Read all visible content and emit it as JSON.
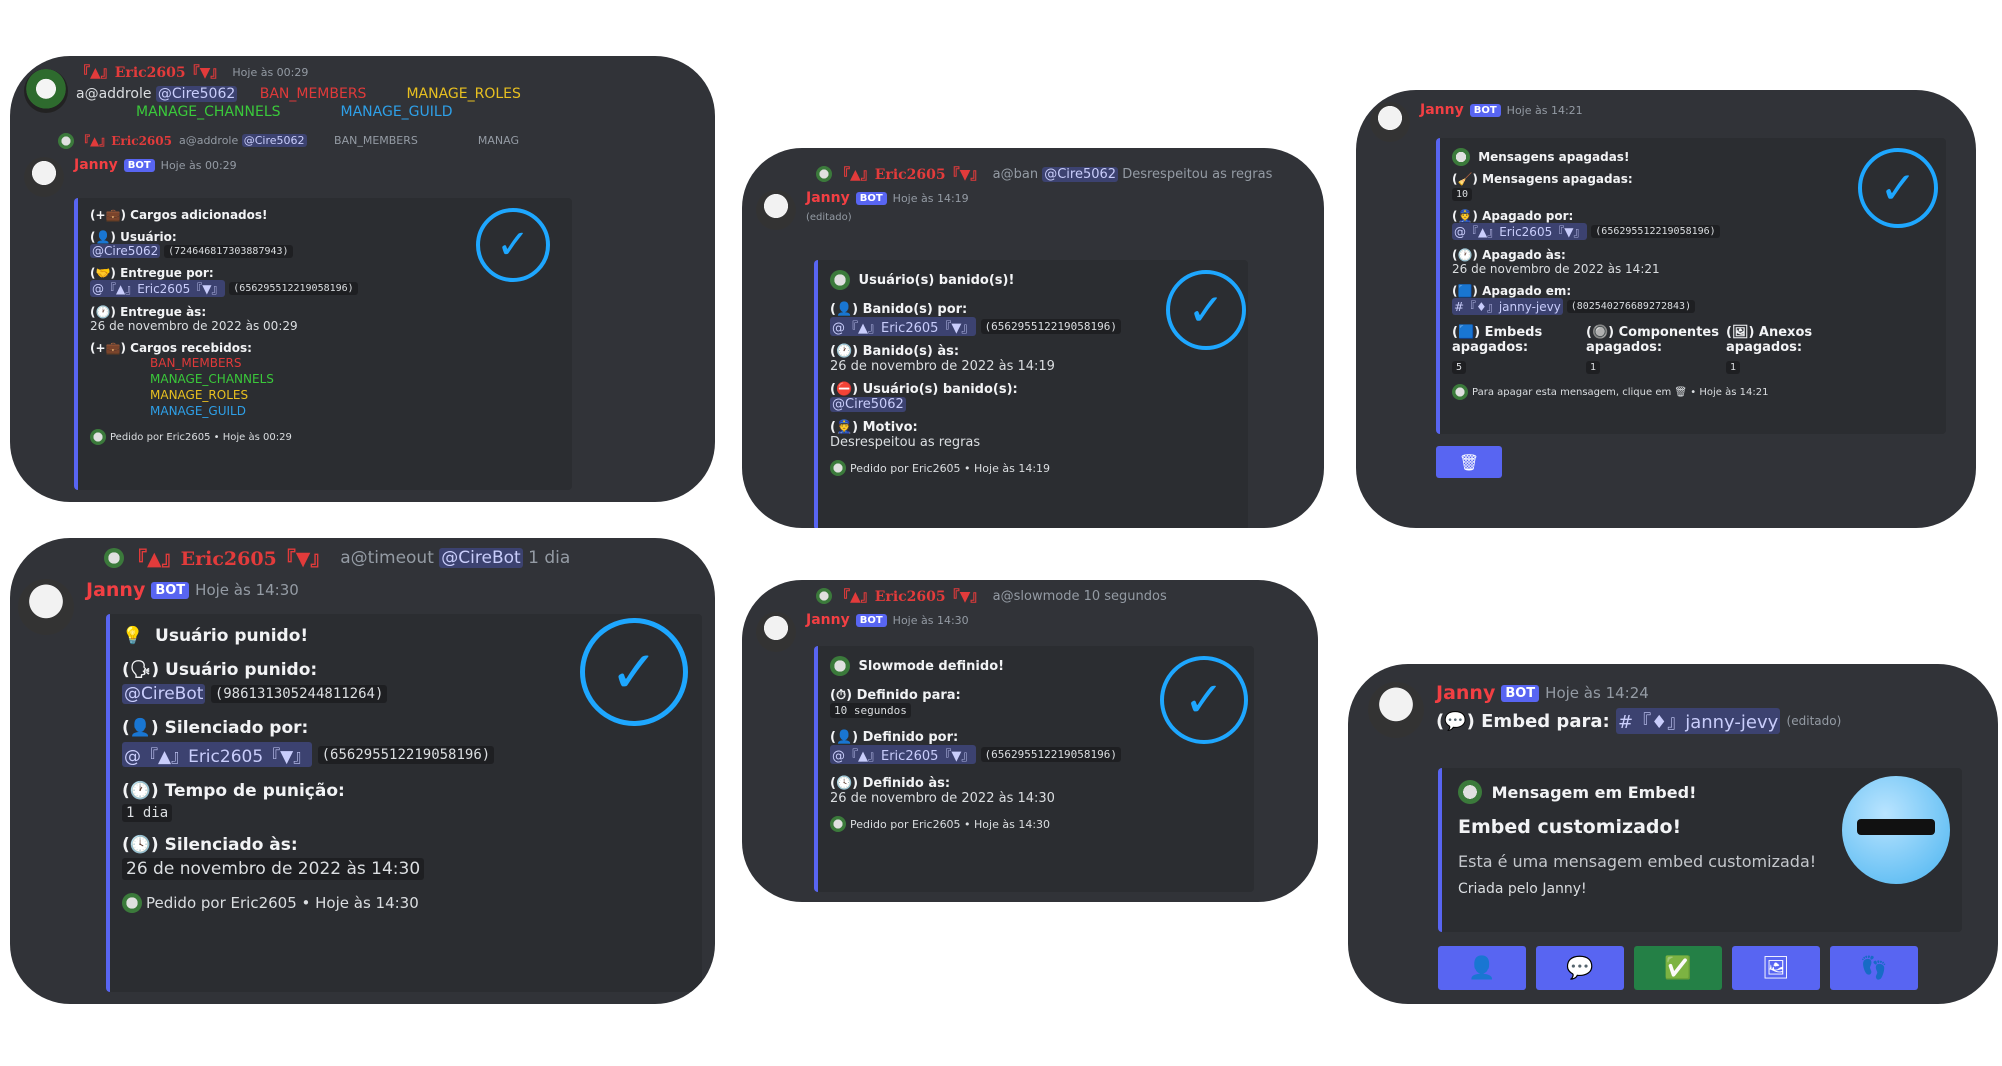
{
  "p1": {
    "user": "『▲』Eric2605『▼』",
    "time": "Hoje às 00:29",
    "cmd_prefix": "a@addrole",
    "mention": "@Cire5062",
    "roles_inline": [
      "BAN_MEMBERS",
      "MANAGE_ROLES",
      "MANAGE_CHANNELS",
      "MANAGE_GUILD"
    ],
    "reply_user": "『▲』Eric2605",
    "reply_text": "a@addrole",
    "reply_mention": "@Cire5062",
    "reply_roles": "BAN_MEMBERS",
    "reply_roles2": "MANAG",
    "bot_name": "Janny",
    "bot_badge": "BOT",
    "bot_time": "Hoje às 00:29",
    "title": "Cargos adicionados!",
    "f1_label": "Usuário:",
    "f1_mention": "@Cire5062",
    "f1_id": "(724646817303887943)",
    "f2_label": "Entregue por:",
    "f2_mention": "@『▲』Eric2605『▼』",
    "f2_id": "(656295512219058196)",
    "f3_label": "Entregue às:",
    "f3_value": "26 de novembro de 2022 às 00:29",
    "f4_label": "Cargos recebidos:",
    "f4_roles": [
      "BAN_MEMBERS",
      "MANAGE_CHANNELS",
      "MANAGE_ROLES",
      "MANAGE_GUILD"
    ],
    "footer": "Pedido por Eric2605 • Hoje às 00:29"
  },
  "p2": {
    "reply_user": "『▲』Eric2605『▼』",
    "reply_text": "a@ban",
    "reply_mention": "@Cire5062",
    "reply_rest": "Desrespeitou as regras",
    "bot_name": "Janny",
    "bot_badge": "BOT",
    "bot_time": "Hoje às 14:19",
    "edited": "(editado)",
    "title": "Usuário(s) banido(s)!",
    "f1_label": "Banido(s) por:",
    "f1_mention": "@『▲』Eric2605『▼』",
    "f1_id": "(656295512219058196)",
    "f2_label": "Banido(s) às:",
    "f2_value": "26 de novembro de 2022 às 14:19",
    "f3_label": "Usuário(s) banido(s):",
    "f3_value": "@Cire5062",
    "f4_label": "Motivo:",
    "f4_value": "Desrespeitou as regras",
    "footer": "Pedido por Eric2605 • Hoje às 14:19"
  },
  "p3": {
    "bot_name": "Janny",
    "bot_badge": "BOT",
    "bot_time": "Hoje às 14:21",
    "title": "Mensagens apagadas!",
    "f1_label": "Mensagens apagadas:",
    "f1_value": "10",
    "f2_label": "Apagado por:",
    "f2_mention": "@『▲』Eric2605『▼』",
    "f2_id": "(656295512219058196)",
    "f3_label": "Apagado às:",
    "f3_value": "26 de novembro de 2022 às 14:21",
    "f4_label": "Apagado em:",
    "f4_channel": "#『♦』janny-jevy",
    "f4_id": "(802540276689272843)",
    "c1_label": "Embeds apagados:",
    "c1_value": "5",
    "c2_label": "Componentes apagados:",
    "c2_value": "1",
    "c3_label": "Anexos apagados:",
    "c3_value": "1",
    "footer": "Para apagar esta mensagem, clique em 🗑 • Hoje às 14:21",
    "button_icon": "trash-icon"
  },
  "p4": {
    "reply_user": "『▲』Eric2605『▼』",
    "reply_text": "a@timeout",
    "reply_mention": "@CireBot",
    "reply_rest": "1 dia",
    "bot_name": "Janny",
    "bot_badge": "BOT",
    "bot_time": "Hoje às 14:30",
    "title": "Usuário punido!",
    "f1_label": "Usuário punido:",
    "f1_mention": "@CireBot",
    "f1_id": "(986131305244811264)",
    "f2_label": "Silenciado por:",
    "f2_mention": "@『▲』Eric2605『▼』",
    "f2_id": "(656295512219058196)",
    "f3_label": "Tempo de punição:",
    "f3_value": "1 dia",
    "f4_label": "Silenciado às:",
    "f4_value": "26 de novembro de 2022 às 14:30",
    "footer": "Pedido por Eric2605 • Hoje às 14:30"
  },
  "p5": {
    "reply_user": "『▲』Eric2605『▼』",
    "reply_text": "a@slowmode 10 segundos",
    "bot_name": "Janny",
    "bot_badge": "BOT",
    "bot_time": "Hoje às 14:30",
    "title": "Slowmode definido!",
    "f1_label": "Definido para:",
    "f1_value": "10 segundos",
    "f2_label": "Definido por:",
    "f2_mention": "@『▲』Eric2605『▼』",
    "f2_id": "(656295512219058196)",
    "f3_label": "Definido às:",
    "f3_value": "26 de novembro de 2022 às 14:30",
    "footer": "Pedido por Eric2605 • Hoje às 14:30"
  },
  "p6": {
    "bot_name": "Janny",
    "bot_badge": "BOT",
    "bot_time": "Hoje às 14:24",
    "line_label": "Embed para:",
    "line_channel": "#『♦』janny-jevy",
    "edited": "(editado)",
    "author": "Mensagem em Embed!",
    "title": "Embed customizado!",
    "desc": "Esta é uma mensagem embed customizada!",
    "desc2": "Criada pelo Janny!",
    "buttons": [
      "user-icon",
      "speech-bubble-icon",
      "checkmark-icon",
      "picture-icon",
      "footprints-icon"
    ]
  },
  "colors": {
    "blurple": "#5865f2",
    "green": "#248046",
    "card_bg": "#313338",
    "embed_bg": "#2b2d31",
    "check": "#1ea7ff"
  }
}
